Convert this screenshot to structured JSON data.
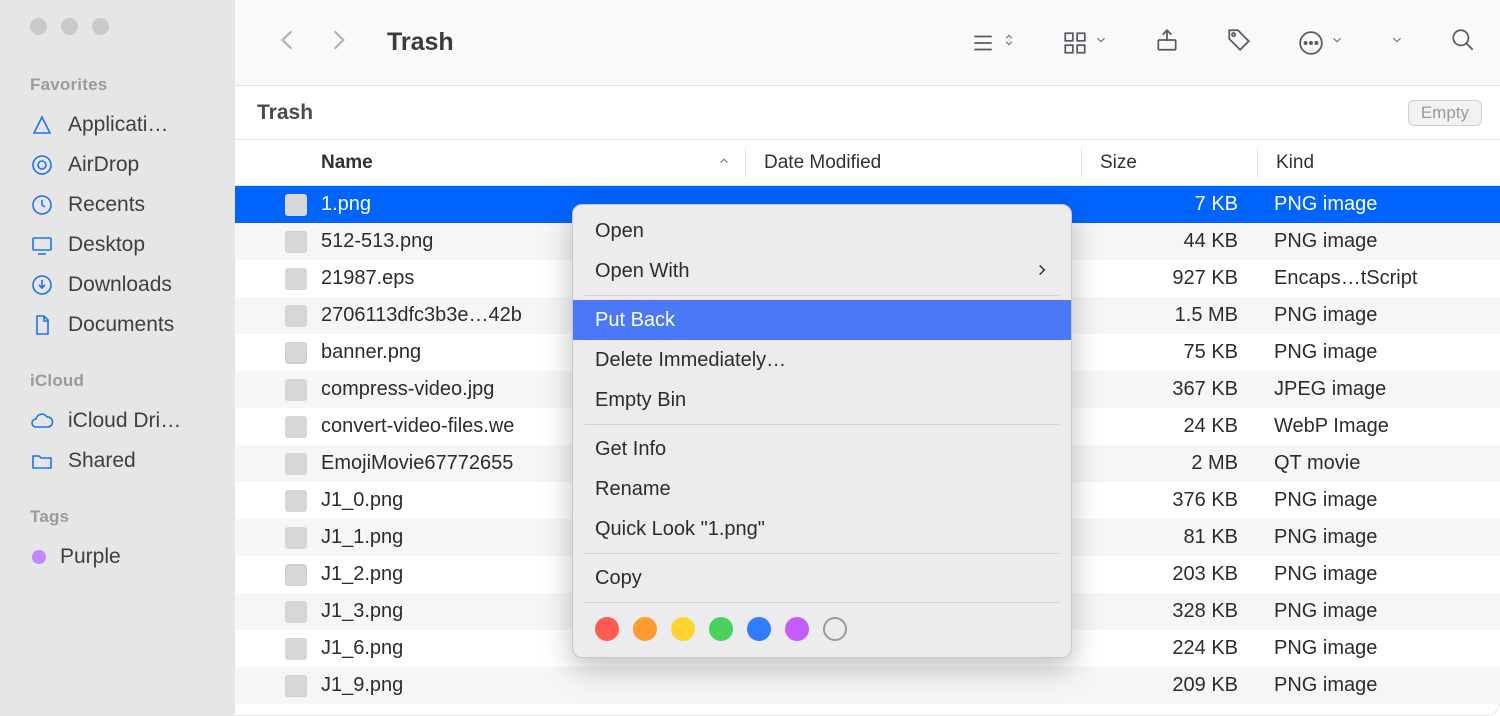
{
  "window": {
    "title": "Trash"
  },
  "sidebar": {
    "favorites_label": "Favorites",
    "icloud_label": "iCloud",
    "tags_label": "Tags",
    "favorites": [
      {
        "label": "Applicati…"
      },
      {
        "label": "AirDrop"
      },
      {
        "label": "Recents"
      },
      {
        "label": "Desktop"
      },
      {
        "label": "Downloads"
      },
      {
        "label": "Documents"
      }
    ],
    "icloud": [
      {
        "label": "iCloud Dri…"
      },
      {
        "label": "Shared"
      }
    ],
    "tags": [
      {
        "label": "Purple"
      }
    ]
  },
  "pathbar": {
    "title": "Trash",
    "empty_button": "Empty"
  },
  "columns": {
    "name": "Name",
    "date": "Date Modified",
    "size": "Size",
    "kind": "Kind"
  },
  "rows": [
    {
      "name": "1.png",
      "size": "7 KB",
      "kind": "PNG image",
      "selected": true
    },
    {
      "name": "512-513.png",
      "size": "44 KB",
      "kind": "PNG image"
    },
    {
      "name": "21987.eps",
      "size": "927 KB",
      "kind": "Encaps…tScript"
    },
    {
      "name": "2706113dfc3b3e…42b",
      "size": "1.5 MB",
      "kind": "PNG image"
    },
    {
      "name": "banner.png",
      "size": "75 KB",
      "kind": "PNG image"
    },
    {
      "name": "compress-video.jpg",
      "size": "367 KB",
      "kind": "JPEG image"
    },
    {
      "name": "convert-video-files.we",
      "size": "24 KB",
      "kind": "WebP Image"
    },
    {
      "name": "EmojiMovie67772655",
      "size": "2 MB",
      "kind": "QT movie"
    },
    {
      "name": "J1_0.png",
      "size": "376 KB",
      "kind": "PNG image"
    },
    {
      "name": "J1_1.png",
      "size": "81 KB",
      "kind": "PNG image"
    },
    {
      "name": "J1_2.png",
      "size": "203 KB",
      "kind": "PNG image"
    },
    {
      "name": "J1_3.png",
      "size": "328 KB",
      "kind": "PNG image"
    },
    {
      "name": "J1_6.png",
      "size": "224 KB",
      "kind": "PNG image"
    },
    {
      "name": "J1_9.png",
      "size": "209 KB",
      "kind": "PNG image"
    }
  ],
  "context_menu": {
    "open": "Open",
    "open_with": "Open With",
    "put_back": "Put Back",
    "delete_immediately": "Delete Immediately…",
    "empty_bin": "Empty Bin",
    "get_info": "Get Info",
    "rename": "Rename",
    "quick_look": "Quick Look \"1.png\"",
    "copy": "Copy"
  }
}
